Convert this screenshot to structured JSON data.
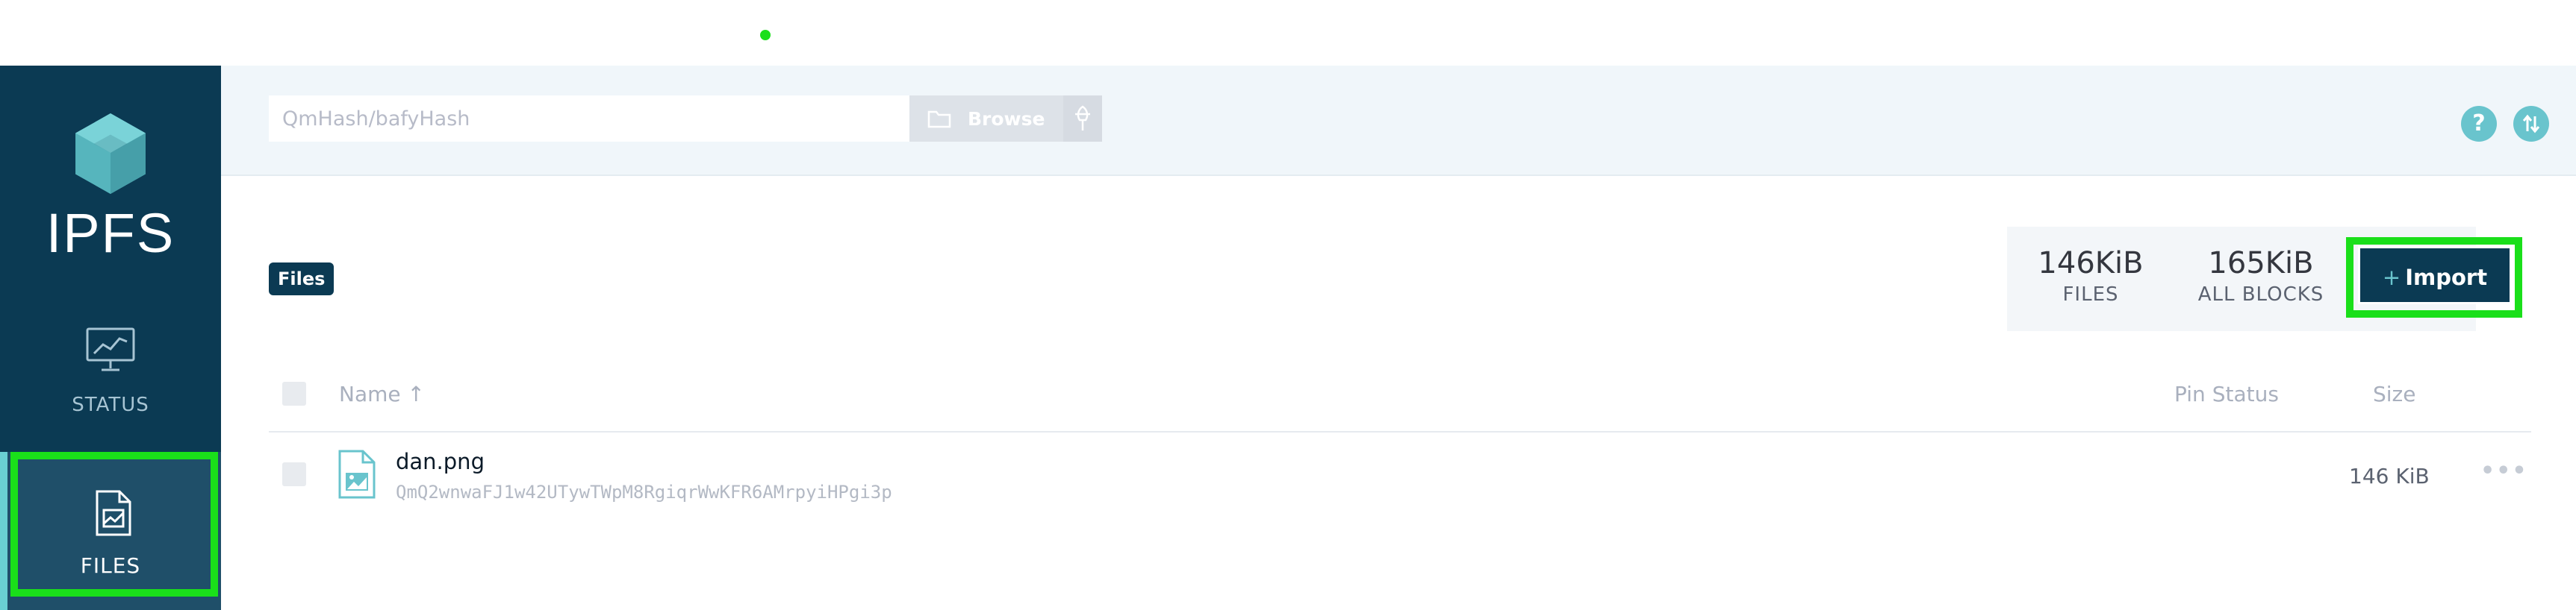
{
  "app": {
    "logo_text": "IPFS"
  },
  "nav": {
    "status_label": "STATUS",
    "files_label": "FILES"
  },
  "search": {
    "placeholder": "QmHash/bafyHash",
    "value": "",
    "browse_label": "Browse"
  },
  "header_icons": {
    "help_glyph": "?"
  },
  "page": {
    "badge": "Files"
  },
  "stats": {
    "files_value": "146KiB",
    "files_label": "FILES",
    "blocks_value": "165KiB",
    "blocks_label": "ALL BLOCKS"
  },
  "import": {
    "plus": "+",
    "label": "Import"
  },
  "table": {
    "columns": {
      "name": "Name ↑",
      "pin_status": "Pin Status",
      "size": "Size"
    },
    "rows": [
      {
        "name": "dan.png",
        "cid": "QmQ2wnwaFJ1w42UTywTWpM8RgiqrWwKFR6AMrpyiHPgi3p",
        "pin_status": "",
        "size": "146 KiB",
        "more": "•••"
      }
    ]
  },
  "colors": {
    "sidebar": "#0b3a53",
    "accent_teal": "#69c4cd",
    "highlight_green": "#1adf1a"
  },
  "icons": {
    "logo": "ipfs-cube-icon",
    "status": "chart-monitor-icon",
    "files": "file-document-icon",
    "browse": "folder-icon",
    "pin": "pin-icon",
    "help": "help-icon",
    "swap": "swap-arrows-icon",
    "file_row": "image-file-icon",
    "more": "more-dots-icon"
  }
}
